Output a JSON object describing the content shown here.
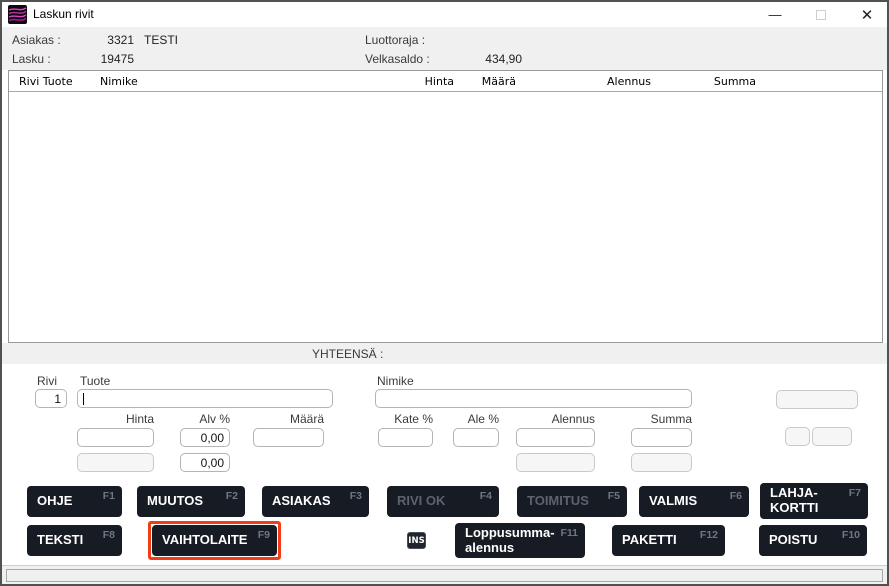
{
  "window": {
    "title": "Laskun rivit",
    "minimize_glyph": "—",
    "close_glyph": "✕"
  },
  "header": {
    "asiakas_label": "Asiakas :",
    "asiakas_number": "3321",
    "asiakas_name": "TESTI",
    "lasku_label": "Lasku :",
    "lasku_number": "19475",
    "luottoraja_label": "Luottoraja :",
    "luottoraja_value": "",
    "velkasaldo_label": "Velkasaldo :",
    "velkasaldo_value": "434,90"
  },
  "table": {
    "col_rivi_tuote": "Rivi Tuote",
    "col_nimike": "Nimike",
    "col_hinta": "Hinta",
    "col_maara": "Määrä",
    "col_alennus": "Alennus",
    "col_summa": "Summa",
    "rows": []
  },
  "totals": {
    "label": "YHTEENSÄ :",
    "value": ""
  },
  "form": {
    "rivi_label": "Rivi",
    "rivi_value": "1",
    "tuote_label": "Tuote",
    "tuote_value": "",
    "nimike_label": "Nimike",
    "nimike_value": "",
    "hinta_label": "Hinta",
    "hinta_value": "",
    "hinta_value_2": "",
    "alv_label": "Alv %",
    "alv_value_1": "0,00",
    "alv_value_2": "0,00",
    "maara_label": "Määrä",
    "maara_value": "",
    "kate_label": "Kate %",
    "kate_value": "",
    "ale_label": "Ale %",
    "ale_value": "",
    "alennus_label": "Alennus",
    "alennus_value": "",
    "alennus_value_2": "",
    "summa_label": "Summa",
    "summa_value": "",
    "summa_value_2": "",
    "extra_value_1": "",
    "extra_value_2": "",
    "extra_value_3": ""
  },
  "ins_badge": "INS",
  "buttons": {
    "row1": [
      {
        "label": "OHJE",
        "fkey": "F1"
      },
      {
        "label": "MUUTOS",
        "fkey": "F2"
      },
      {
        "label": "ASIAKAS",
        "fkey": "F3"
      },
      {
        "label": "RIVI OK",
        "fkey": "F4"
      },
      {
        "label": "TOIMITUS",
        "fkey": "F5"
      },
      {
        "label": "VALMIS",
        "fkey": "F6"
      },
      {
        "label": "LAHJA-KORTTI",
        "fkey": "F7"
      }
    ],
    "row2": [
      {
        "label": "TEKSTI",
        "fkey": "F8"
      },
      {
        "label": "VAIHTOLAITE",
        "fkey": "F9"
      },
      {
        "label": "Loppusumma-alennus",
        "fkey": "F11"
      },
      {
        "label": "PAKETTI",
        "fkey": "F12"
      },
      {
        "label": "POISTU",
        "fkey": "F10"
      }
    ]
  },
  "colors": {
    "button_bg": "#171b24",
    "highlight_red": "#f03c17",
    "panel_gray": "#f0f0f0",
    "icon_magenta": "#d944c9"
  }
}
